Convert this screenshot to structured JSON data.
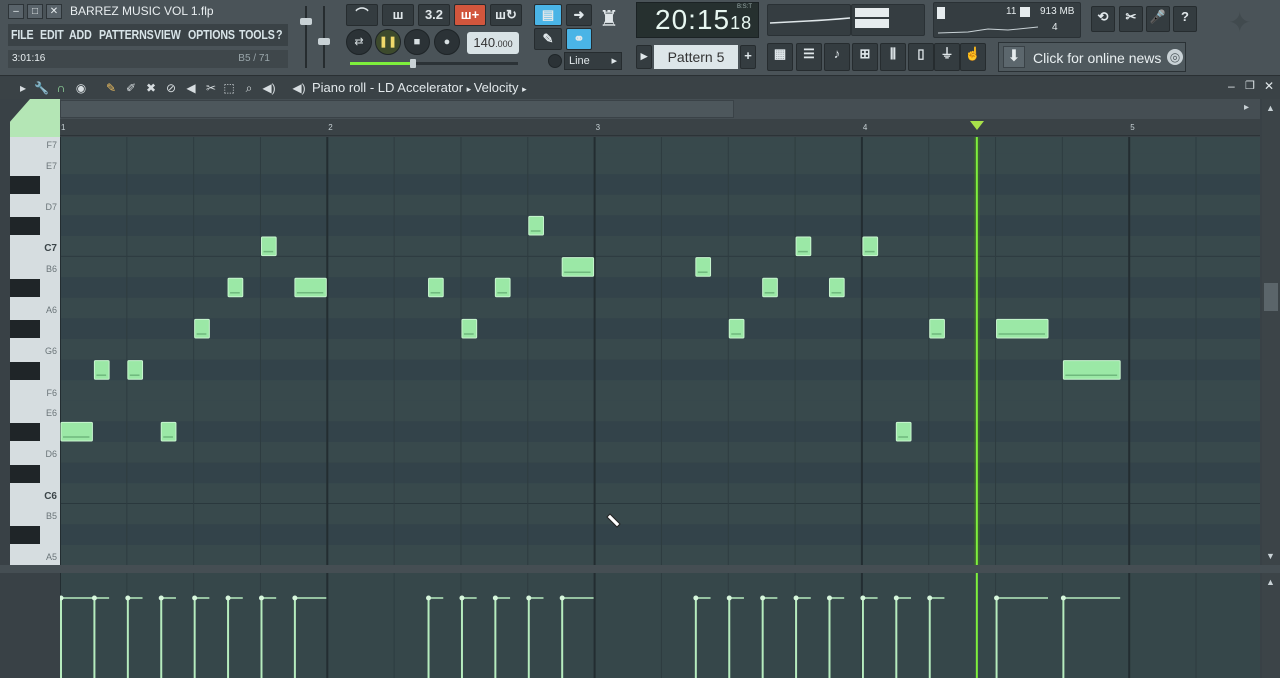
{
  "window": {
    "title": "BARREZ MUSIC VOL 1.flp"
  },
  "menu": [
    "FILE",
    "EDIT",
    "ADD",
    "PATTERNS",
    "VIEW",
    "OPTIONS",
    "TOOLS",
    "?"
  ],
  "hint": {
    "position": "3:01:16",
    "note": "B5 / 71"
  },
  "transport": {
    "time_main": "20:15",
    "time_sub": "18",
    "time_label": "B:S:T",
    "tempo_int": "140",
    "tempo_dec": ".000",
    "snap_label": "3.2"
  },
  "snap": {
    "mode": "Line"
  },
  "pattern": {
    "name": "Pattern 5"
  },
  "monitor": {
    "cpu": "11",
    "memory": "913 MB",
    "polyphony": "4"
  },
  "news": {
    "text": "Click for online news"
  },
  "pianoroll": {
    "breadcrumb": [
      "Piano roll",
      "LD Accelerator",
      "Velocity"
    ],
    "bars": [
      "1",
      "2",
      "3",
      "4",
      "5"
    ],
    "key_labels": [
      "F7",
      "E7",
      "D7",
      "C7",
      "B6",
      "A6",
      "G6",
      "F6",
      "E6",
      "D6",
      "C6",
      "B5",
      "A5"
    ],
    "playhead_bar": 4.43
  },
  "colors": {
    "note": "#9be8a6",
    "note_border": "#c8f5cf",
    "playhead": "#7ef03c",
    "grid_bg": "#36474a"
  },
  "notes": [
    {
      "key": "D#6",
      "start": 1.0,
      "length": 0.125
    },
    {
      "key": "F#6",
      "start": 1.125,
      "length": 0.0625
    },
    {
      "key": "F#6",
      "start": 1.25,
      "length": 0.0625
    },
    {
      "key": "D#6",
      "start": 1.375,
      "length": 0.0625
    },
    {
      "key": "G#6",
      "start": 1.5,
      "length": 0.0625
    },
    {
      "key": "A#6",
      "start": 1.625,
      "length": 0.0625
    },
    {
      "key": "C7",
      "start": 1.75,
      "length": 0.0625
    },
    {
      "key": "A#6",
      "start": 1.875,
      "length": 0.125
    },
    {
      "key": "A#6",
      "start": 2.375,
      "length": 0.0625
    },
    {
      "key": "G#6",
      "start": 2.5,
      "length": 0.0625
    },
    {
      "key": "A#6",
      "start": 2.625,
      "length": 0.0625
    },
    {
      "key": "C#7",
      "start": 2.75,
      "length": 0.0625
    },
    {
      "key": "B6",
      "start": 2.875,
      "length": 0.125
    },
    {
      "key": "B6",
      "start": 3.375,
      "length": 0.0625
    },
    {
      "key": "G#6",
      "start": 3.5,
      "length": 0.0625
    },
    {
      "key": "A#6",
      "start": 3.625,
      "length": 0.0625
    },
    {
      "key": "C7",
      "start": 3.75,
      "length": 0.0625
    },
    {
      "key": "A#6",
      "start": 3.875,
      "length": 0.0625
    },
    {
      "key": "C7",
      "start": 4.0,
      "length": 0.0625
    },
    {
      "key": "D#6",
      "start": 4.125,
      "length": 0.0625
    },
    {
      "key": "G#6",
      "start": 4.25,
      "length": 0.0625
    },
    {
      "key": "G#6",
      "start": 4.5,
      "length": 0.2
    },
    {
      "key": "F#6",
      "start": 4.75,
      "length": 0.22
    }
  ]
}
